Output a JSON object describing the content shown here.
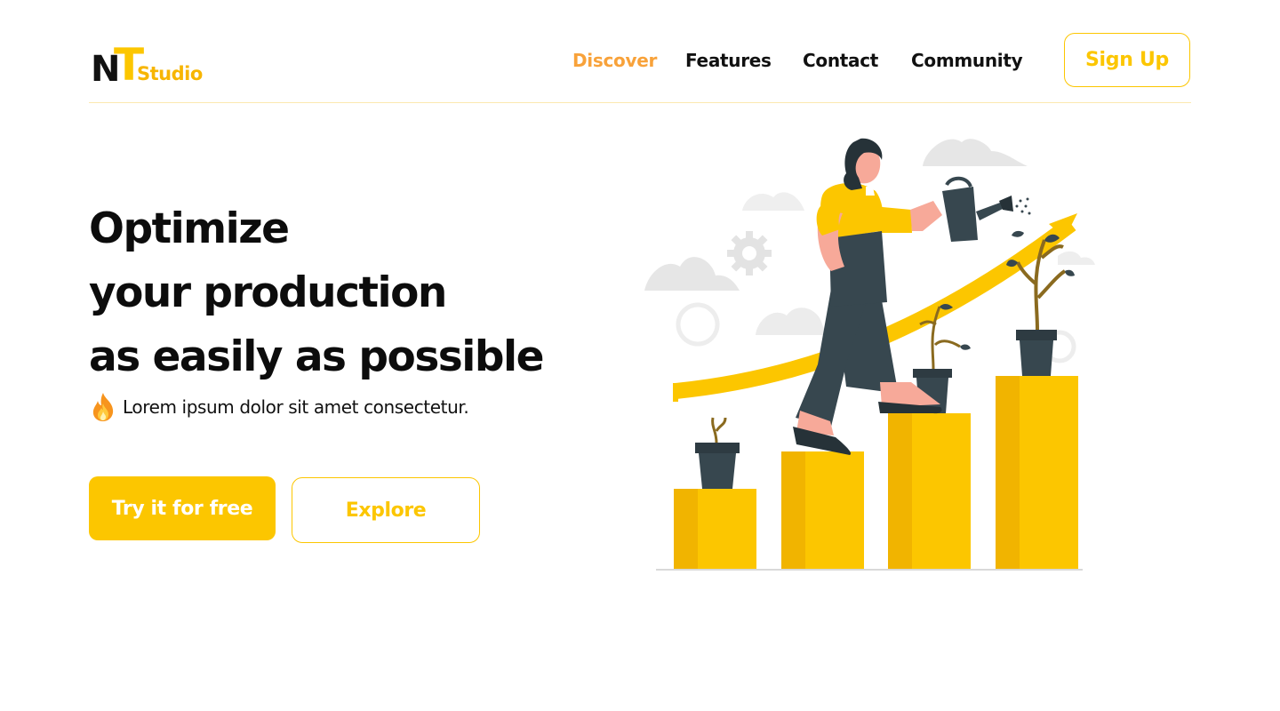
{
  "header": {
    "logo": {
      "letters_main": "N",
      "letters_accent": "T",
      "wordmark": "Studio"
    },
    "nav": [
      {
        "label": "Discover",
        "active": true
      },
      {
        "label": "Features",
        "active": false
      },
      {
        "label": "Contact",
        "active": false
      },
      {
        "label": "Community",
        "active": false
      }
    ],
    "signup_label": "Sign Up"
  },
  "hero": {
    "title_lines": [
      "Optimize",
      "your production",
      "as easily as possible"
    ],
    "subtitle": "Lorem ipsum dolor sit amet consectetur.",
    "subtitle_icon": "fire-icon",
    "primary_cta": "Try it for free",
    "secondary_cta": "Explore"
  },
  "illustration": {
    "description_icon": "woman-watering-plants-growth-chart-illustration"
  },
  "colors": {
    "accent": "#fcc600",
    "nav_active": "#f8a23a",
    "text": "#0c0c0c",
    "bar_dark": "#f1b400",
    "pot": "#37474f"
  }
}
